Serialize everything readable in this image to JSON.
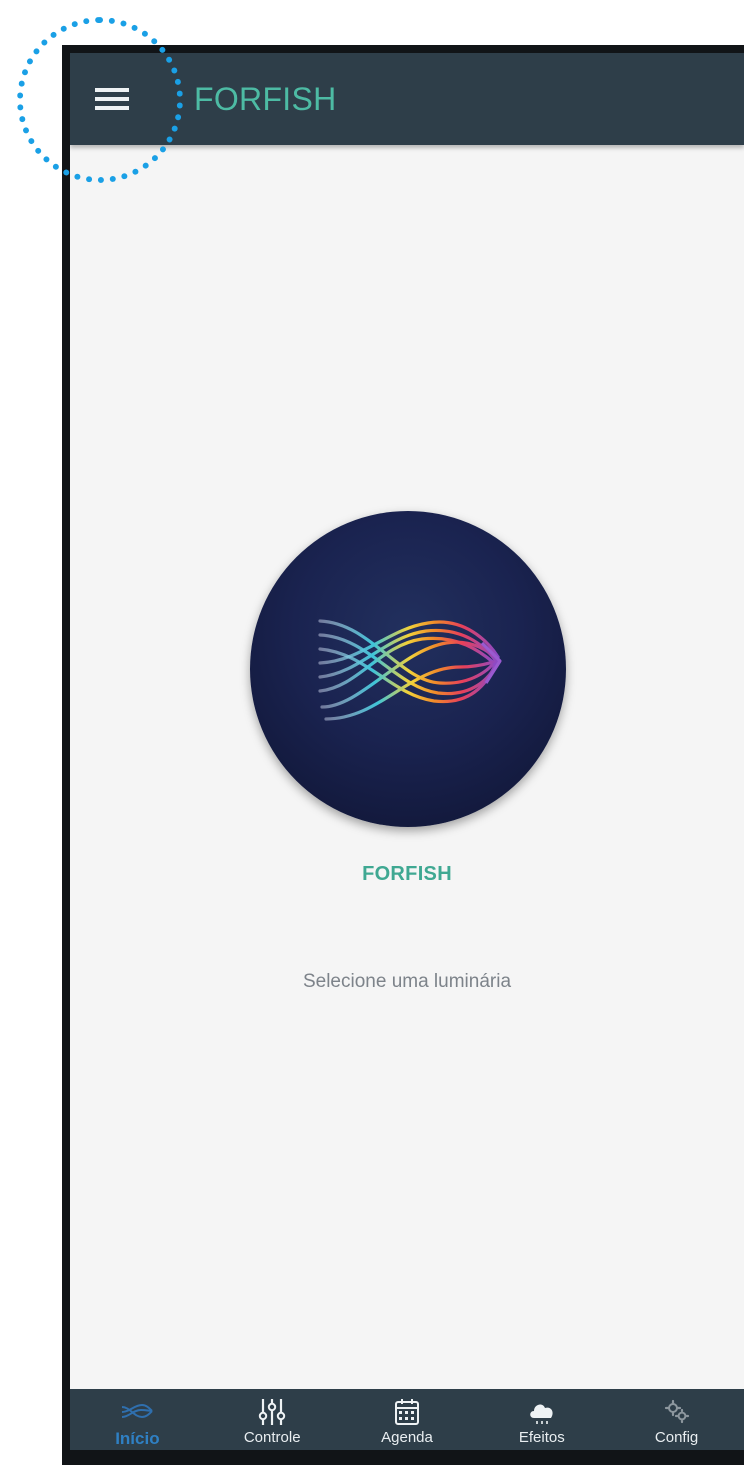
{
  "app_bar": {
    "title": "FORFISH",
    "menu_icon": "hamburger-menu-icon"
  },
  "main": {
    "logo_icon": "forfish-fish-logo-icon",
    "brand_name": "FORFISH",
    "hint": "Selecione uma luminária"
  },
  "bottom_nav": {
    "items": [
      {
        "label": "Início",
        "icon": "fish-icon",
        "active": true
      },
      {
        "label": "Controle",
        "icon": "sliders-icon",
        "active": false
      },
      {
        "label": "Agenda",
        "icon": "calendar-icon",
        "active": false
      },
      {
        "label": "Efeitos",
        "icon": "cloud-icon",
        "active": false
      },
      {
        "label": "Config",
        "icon": "gears-icon",
        "active": false
      }
    ]
  },
  "colors": {
    "app_bar_bg": "#2e3e49",
    "accent_teal": "#4dbba4",
    "active_nav": "#2f80c4",
    "screen_bg": "#f5f5f5",
    "highlight": "#1aa0e6"
  }
}
